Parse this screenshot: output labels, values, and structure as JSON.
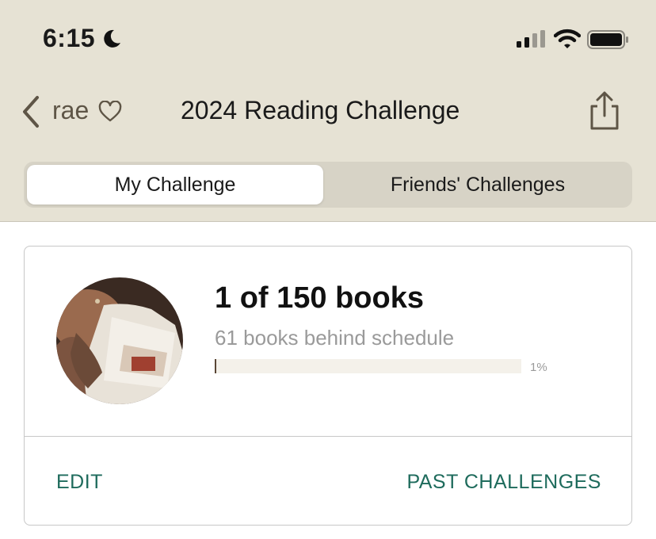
{
  "status_bar": {
    "time": "6:15"
  },
  "nav": {
    "back_label": "rae",
    "title": "2024 Reading Challenge"
  },
  "tabs": [
    {
      "label": "My Challenge",
      "active": true
    },
    {
      "label": "Friends' Challenges",
      "active": false
    }
  ],
  "challenge": {
    "progress_text": "1 of 150 books",
    "schedule_text": "61 books behind schedule",
    "progress_fraction": 0.01,
    "progress_percent_label": "1%",
    "edit_label": "EDIT",
    "past_label": "PAST CHALLENGES"
  },
  "colors": {
    "header_bg": "#e6e2d4",
    "accent_link": "#1e6b5c",
    "progress_fill": "#5a4636"
  }
}
